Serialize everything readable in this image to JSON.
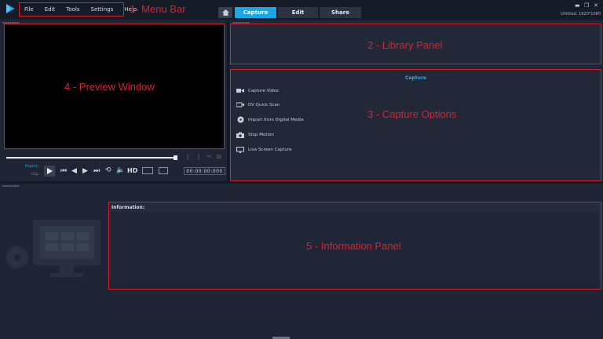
{
  "menu": [
    "File",
    "Edit",
    "Tools",
    "Settings",
    "Help"
  ],
  "annotations": {
    "menu_bar": "1- Menu Bar",
    "library_panel": "2 - Library Panel",
    "capture_options": "3 - Capture Options",
    "preview_window": "4 - Preview Window",
    "information_panel": "5 - Information Panel"
  },
  "tabs": [
    {
      "label": "Capture",
      "active": true
    },
    {
      "label": "Edit",
      "active": false
    },
    {
      "label": "Share",
      "active": false
    }
  ],
  "project_name": "Untitled, 1920*1080",
  "capture": {
    "title": "Capture",
    "items": [
      {
        "label": "Capture Video",
        "icon": "video-camera-icon"
      },
      {
        "label": "DV Quick Scan",
        "icon": "dv-scan-icon"
      },
      {
        "label": "Import from Digital Media",
        "icon": "digital-media-icon"
      },
      {
        "label": "Stop Motion",
        "icon": "stop-motion-camera-icon"
      },
      {
        "label": "Live Screen Capture",
        "icon": "screen-capture-icon"
      }
    ]
  },
  "player": {
    "project_label": "Project–",
    "clip_label": "Clip–",
    "hd_label": "HD",
    "timecode": "00:00:00:000"
  },
  "information": {
    "label": "Information:"
  },
  "colors": {
    "accent": "#18a8e6",
    "annotation": "#d8222e",
    "background": "#1f2535"
  }
}
